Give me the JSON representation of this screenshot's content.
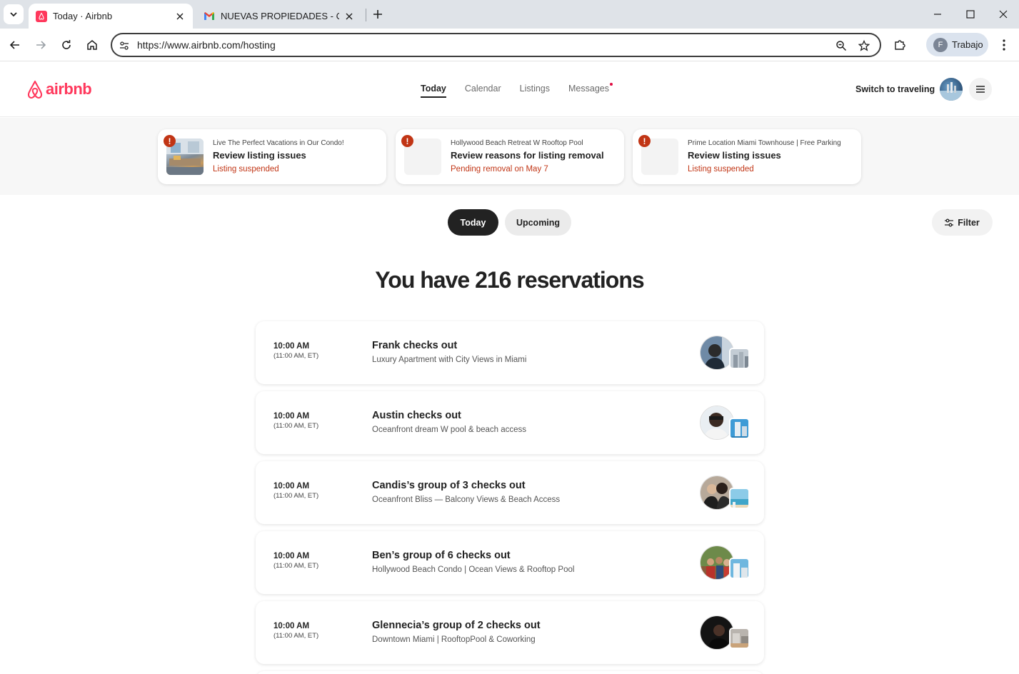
{
  "browser": {
    "tabs": [
      {
        "title": "Today · Airbnb",
        "active": true,
        "favicon": "airbnb-icon"
      },
      {
        "title": "NUEVAS PROPIEDADES - Chat",
        "active": false,
        "favicon": "gmail-icon"
      }
    ],
    "url": "https://www.airbnb.com/hosting",
    "profile_initial": "F",
    "profile_label": "Trabajo"
  },
  "header": {
    "logo_text": "airbnb",
    "nav": [
      {
        "label": "Today",
        "active": true
      },
      {
        "label": "Calendar",
        "active": false
      },
      {
        "label": "Listings",
        "active": false
      },
      {
        "label": "Messages",
        "active": false,
        "badge_dot": true
      }
    ],
    "switch_label": "Switch to traveling"
  },
  "alerts": [
    {
      "listing": "Live The Perfect Vacations in Our Condo!",
      "heading": "Review listing issues",
      "status": "Listing suspended"
    },
    {
      "listing": "Hollywood Beach Retreat W Rooftop Pool",
      "heading": "Review reasons for listing removal",
      "status": "Pending removal on May 7"
    },
    {
      "listing": "Prime Location Miami Townhouse | Free Parking",
      "heading": "Review listing issues",
      "status": "Listing suspended"
    }
  ],
  "toggle": {
    "today": "Today",
    "upcoming": "Upcoming"
  },
  "filter_label": "Filter",
  "summary": "You have 216 reservations",
  "reservations": [
    {
      "time": "10:00 AM",
      "tz": "(11:00 AM, ET)",
      "guest": "Frank checks out",
      "listing": "Luxury Apartment with City Views in Miami"
    },
    {
      "time": "10:00 AM",
      "tz": "(11:00 AM, ET)",
      "guest": "Austin checks out",
      "listing": "Oceanfront dream W pool & beach access"
    },
    {
      "time": "10:00 AM",
      "tz": "(11:00 AM, ET)",
      "guest": "Candis’s group of 3 checks out",
      "listing": "Oceanfront Bliss — Balcony Views & Beach Access"
    },
    {
      "time": "10:00 AM",
      "tz": "(11:00 AM, ET)",
      "guest": "Ben’s group of 6 checks out",
      "listing": "Hollywood Beach Condo | Ocean Views & Rooftop Pool"
    },
    {
      "time": "10:00 AM",
      "tz": "(11:00 AM, ET)",
      "guest": "Glennecia’s group of 2 checks out",
      "listing": "Downtown Miami | RooftopPool & Coworking"
    }
  ],
  "colors": {
    "brand": "#ff385c",
    "alert_red": "#c13515",
    "dark": "#222222"
  }
}
